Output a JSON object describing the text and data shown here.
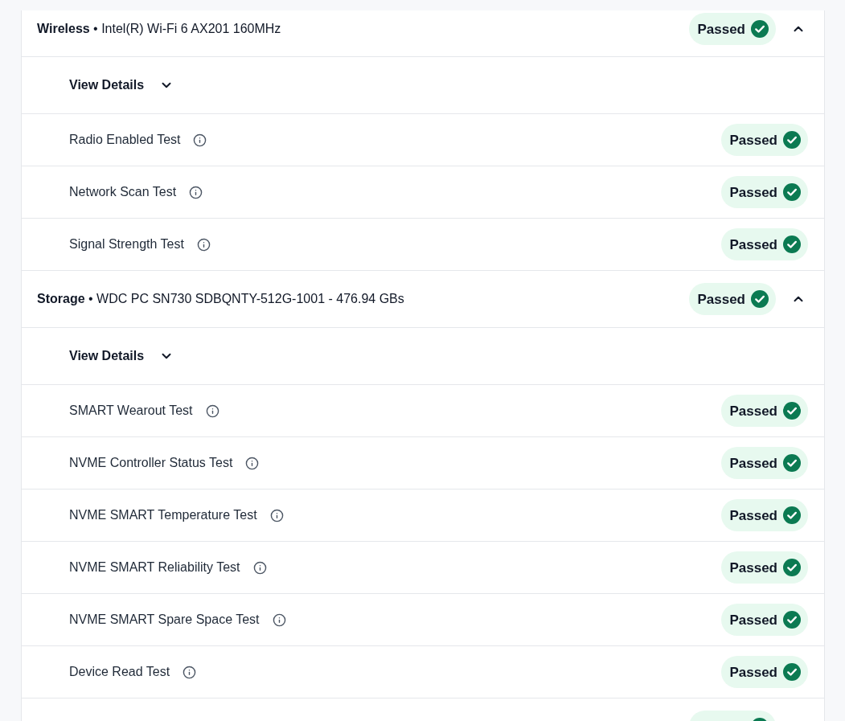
{
  "sections": [
    {
      "title": "**Wireless** • Intel(R) Wi-Fi 6 AX201 160MHz",
      "status": {
        "kind": "passed",
        "label": "Passed"
      },
      "expanded": true,
      "details": {
        "label": "View Details",
        "expanded": false
      },
      "tests": [
        {
          "name": "Radio Enabled Test",
          "status": {
            "kind": "passed",
            "label": "Passed"
          }
        },
        {
          "name": "Network Scan Test",
          "status": {
            "kind": "passed",
            "label": "Passed"
          }
        },
        {
          "name": "Signal Strength Test",
          "status": {
            "kind": "passed",
            "label": "Passed"
          }
        }
      ]
    },
    {
      "title": "**Storage** • WDC PC SN730 SDBQNTY-512G-1001 - 476.94 GBs",
      "status": {
        "kind": "passed",
        "label": "Passed"
      },
      "expanded": true,
      "details": {
        "label": "View Details",
        "expanded": false
      },
      "tests": [
        {
          "name": "SMART Wearout Test",
          "status": {
            "kind": "passed",
            "label": "Passed"
          }
        },
        {
          "name": "NVME Controller Status Test",
          "status": {
            "kind": "passed",
            "label": "Passed"
          }
        },
        {
          "name": "NVME SMART Temperature Test",
          "status": {
            "kind": "passed",
            "label": "Passed"
          }
        },
        {
          "name": "NVME SMART Reliability Test",
          "status": {
            "kind": "passed",
            "label": "Passed"
          }
        },
        {
          "name": "NVME SMART Spare Space Test",
          "status": {
            "kind": "passed",
            "label": "Passed"
          }
        },
        {
          "name": "Device Read Test",
          "status": {
            "kind": "passed",
            "label": "Passed"
          }
        }
      ]
    },
    {
      "status": {
        "kind": "passed"
      }
    }
  ]
}
